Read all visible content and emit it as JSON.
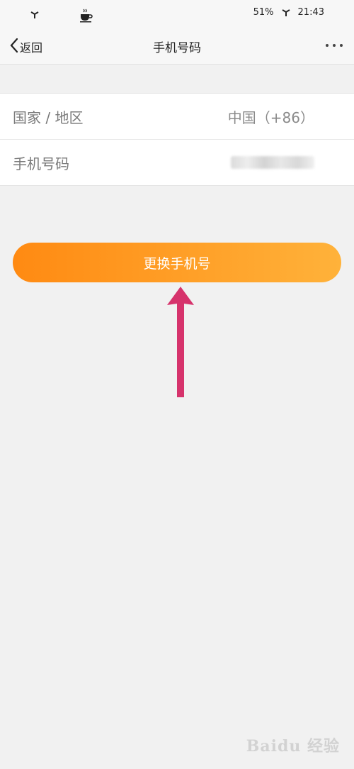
{
  "status_bar": {
    "battery": "51%",
    "time": "21:43"
  },
  "header": {
    "back_label": "返回",
    "title": "手机号码"
  },
  "rows": [
    {
      "label": "国家 / 地区",
      "value": "中国（+86）"
    },
    {
      "label": "手机号码",
      "value": ""
    }
  ],
  "button": {
    "label": "更换手机号"
  },
  "watermark": "Baidu 经验",
  "colors": {
    "button_start": "#ff8a12",
    "button_end": "#ffb23a",
    "arrow": "#d6336c",
    "background": "#f1f1f1"
  }
}
